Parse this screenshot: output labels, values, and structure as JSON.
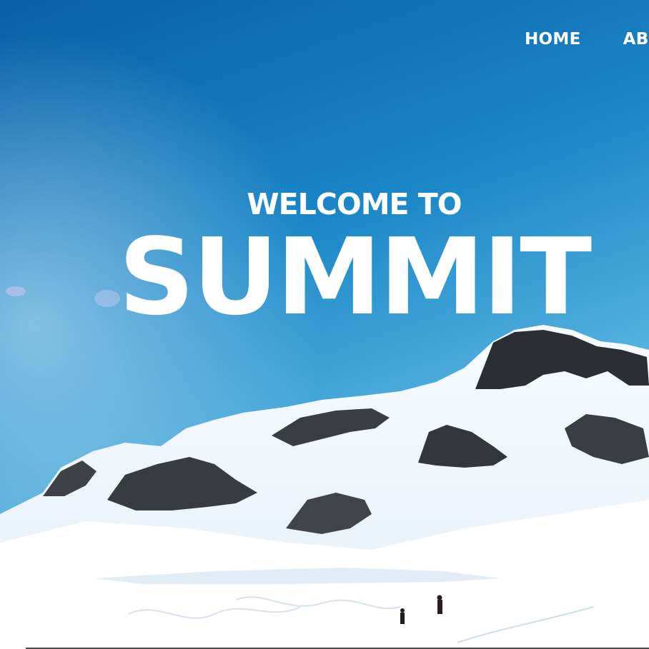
{
  "nav": {
    "items": [
      {
        "label": "HOME"
      },
      {
        "label": "ABOUT"
      }
    ]
  },
  "hero": {
    "welcome": "WELCOME TO",
    "title": "SUMMIT"
  },
  "colors": {
    "sky_top": "#0a62a8",
    "sky_bottom": "#3aa3d8",
    "snow": "#ffffff",
    "rock": "#2d2f33",
    "text": "#ffffff"
  }
}
